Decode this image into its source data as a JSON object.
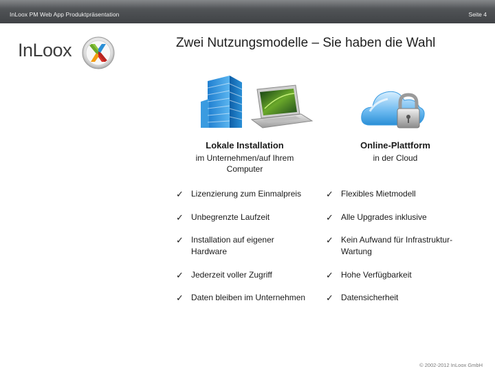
{
  "header": {
    "left_text": "InLoox PM Web App Produktpräsentation",
    "page_label": "Seite 4"
  },
  "logo": {
    "text": "InLoox"
  },
  "title": "Zwei Nutzungsmodelle – Sie haben die Wahl",
  "colors": {
    "accent_blue": "#2a8fd6",
    "logo_green": "#8cc63f",
    "logo_red": "#d9302a",
    "logo_orange": "#f39c12"
  },
  "left_column": {
    "heading": "Lokale Installation",
    "subheading": "im Unternehmen/auf Ihrem Computer",
    "items": [
      "Lizenzierung zum Einmalpreis",
      "Unbegrenzte Laufzeit",
      "Installation auf eigener Hardware",
      "Jederzeit voller Zugriff",
      "Daten bleiben im Unternehmen"
    ]
  },
  "right_column": {
    "heading": "Online-Plattform",
    "subheading": "in der Cloud",
    "items": [
      "Flexibles Mietmodell",
      "Alle Upgrades inklusive",
      "Kein Aufwand für Infrastruktur-Wartung",
      "Hohe Verfügbarkeit",
      "Datensicherheit"
    ]
  },
  "icons": {
    "check": "check-icon",
    "building": "building-icon",
    "laptop": "laptop-icon",
    "cloud": "cloud-icon",
    "lock": "lock-icon"
  },
  "footer": {
    "copyright": "© 2002-2012 InLoox GmbH"
  }
}
